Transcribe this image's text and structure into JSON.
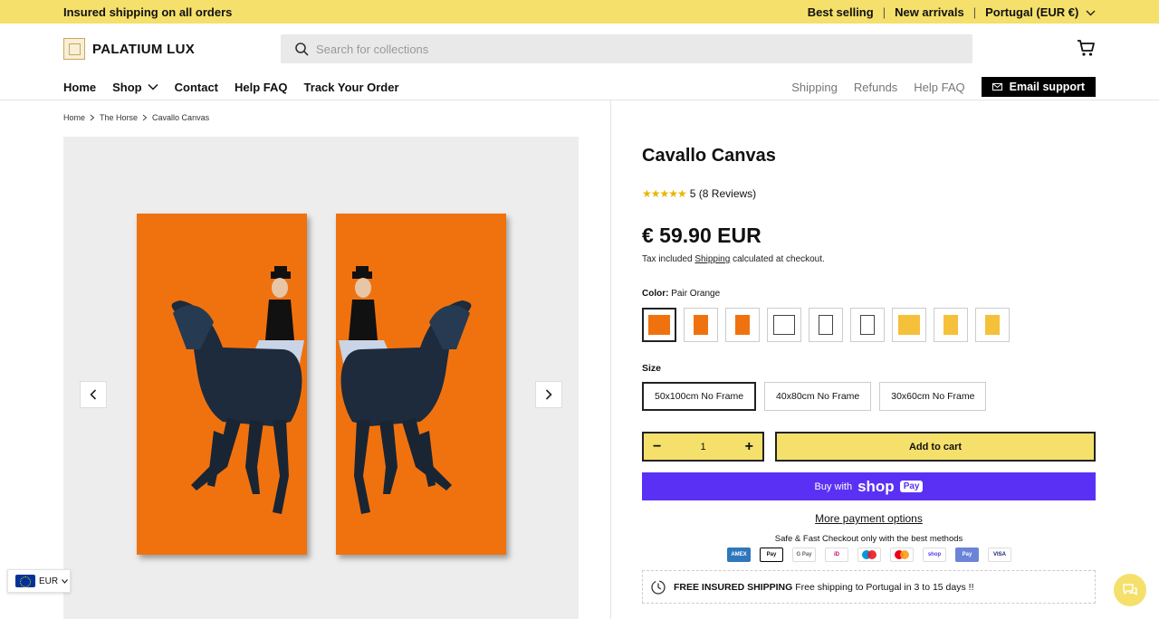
{
  "announcement": {
    "text": "Insured shipping on all orders",
    "links": [
      "Best selling",
      "New arrivals",
      "Portugal (EUR €)"
    ],
    "separator": "|"
  },
  "header": {
    "logo_text": "PALATIUM LUX",
    "search_placeholder": "Search for collections"
  },
  "nav": {
    "left": [
      "Home",
      "Shop",
      "Contact",
      "Help FAQ",
      "Track Your Order"
    ],
    "right": [
      "Shipping",
      "Refunds",
      "Help FAQ"
    ],
    "email_support": "Email support"
  },
  "breadcrumb": [
    "Home",
    "The Horse",
    "Cavallo Canvas"
  ],
  "product": {
    "title": "Cavallo Canvas",
    "stars": "★★★★★",
    "rating_text": "5 (8 Reviews)",
    "price": "€ 59.90 EUR",
    "tax_prefix": "Tax included ",
    "tax_link": "Shipping",
    "tax_suffix": " calculated at checkout.",
    "color_label": "Color:",
    "color_value": "Pair Orange",
    "size_label": "Size",
    "sizes": [
      "50x100cm No Frame",
      "40x80cm No Frame",
      "30x60cm No Frame"
    ],
    "quantity": "1",
    "add_to_cart": "Add to cart",
    "buy_with": "Buy with",
    "shop_brand": "shop",
    "shop_pay": "Pay",
    "more_options": "More payment options",
    "safe_checkout": "Safe & Fast Checkout only with the best methods",
    "payment_cards": [
      "AMEX",
      "Pay",
      "G Pay",
      "iD",
      "",
      "",
      "shop",
      "Pay",
      "VISA"
    ],
    "free_shipping_bold": "FREE INSURED SHIPPING",
    "free_shipping_text": " Free shipping to Portugal in 3 to 15 days !!"
  },
  "swatch_colors": [
    "#f0720f",
    "#f0720f",
    "#f0720f",
    "#ffffff",
    "#ffffff",
    "#ffffff",
    "#f5c13a",
    "#f5c13a",
    "#f5c13a"
  ],
  "currency": {
    "code": "EUR"
  },
  "colors": {
    "accent": "#f5e06b",
    "shop_pay": "#5a31f4",
    "orange": "#f0720f"
  }
}
